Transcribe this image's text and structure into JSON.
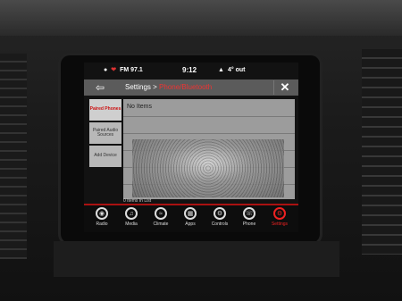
{
  "status": {
    "radio": "FM 97.1",
    "time": "9:12",
    "temperature": "4° out"
  },
  "header": {
    "back_icon": "back-arrow-icon",
    "breadcrumb_root": "Settings",
    "breadcrumb_sep": ">",
    "breadcrumb_current": "Phone/Bluetooth",
    "close_icon": "close-icon"
  },
  "tabs": [
    {
      "label": "Paired Phones",
      "active": true
    },
    {
      "label": "Paired Audio Sources",
      "active": false
    },
    {
      "label": "Add Device",
      "active": false
    }
  ],
  "list": {
    "empty_label": "No Items",
    "count_label": "0 Items In List"
  },
  "nav": [
    {
      "label": "Radio",
      "icon": "radio-icon"
    },
    {
      "label": "Media",
      "icon": "media-icon"
    },
    {
      "label": "Climate",
      "icon": "climate-icon"
    },
    {
      "label": "Apps",
      "icon": "apps-icon"
    },
    {
      "label": "Controls",
      "icon": "controls-icon"
    },
    {
      "label": "Phone",
      "icon": "phone-icon"
    },
    {
      "label": "Settings",
      "icon": "settings-icon",
      "selected": true
    }
  ],
  "colors": {
    "accent": "#e22222",
    "header_bg": "#5b5b5b"
  }
}
